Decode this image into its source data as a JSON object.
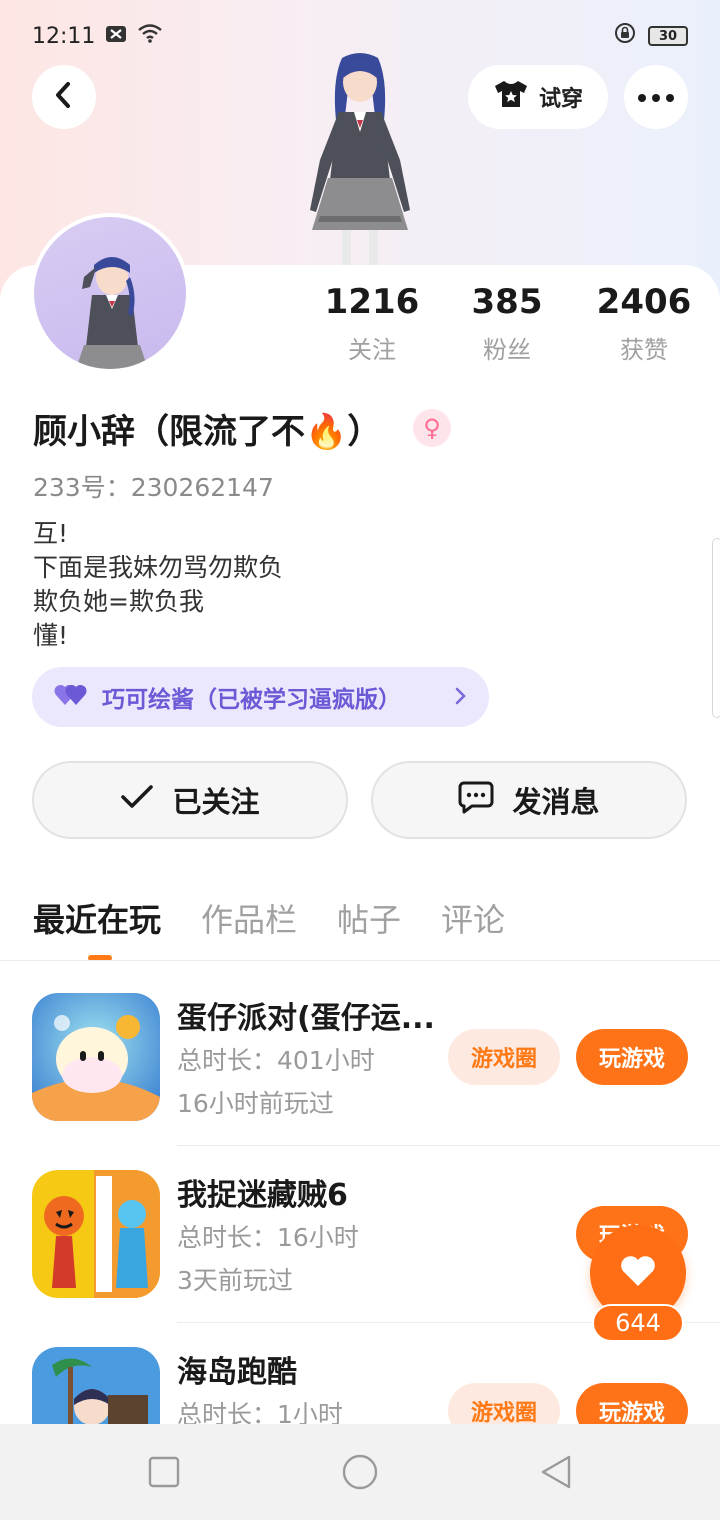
{
  "status_bar": {
    "time": "12:11",
    "battery": "30"
  },
  "header": {
    "tryon_label": "试穿"
  },
  "profile": {
    "name": "顾小辞（限流了不🔥）",
    "gender_symbol": "♀",
    "id_text": "233号：230262147",
    "bio": [
      "互!",
      "下面是我妹勿骂勿欺负",
      "欺负她=欺负我",
      "懂!"
    ],
    "cp_tag": "巧可绘酱（已被学习逼疯版）",
    "stats": [
      {
        "value": "1216",
        "label": "关注"
      },
      {
        "value": "385",
        "label": "粉丝"
      },
      {
        "value": "2406",
        "label": "获赞"
      }
    ]
  },
  "actions": {
    "follow_label": "已关注",
    "message_label": "发消息"
  },
  "tabs": [
    "最近在玩",
    "作品栏",
    "帖子",
    "评论"
  ],
  "games": [
    {
      "title": "蛋仔派对(蛋仔运...",
      "duration": "总时长：401小时",
      "last_played": "16小时前玩过",
      "circle_label": "游戏圈",
      "play_label": "玩游戏"
    },
    {
      "title": "我捉迷藏贼6",
      "duration": "总时长：16小时",
      "last_played": "3天前玩过",
      "circle_label": "",
      "play_label": "玩游戏"
    },
    {
      "title": "海岛跑酷",
      "duration": "总时长：1小时",
      "last_played": "",
      "circle_label": "游戏圈",
      "play_label": "玩游戏"
    }
  ],
  "like_fab": {
    "count": "644"
  },
  "colors": {
    "accent": "#ff7318",
    "tag_purple": "#6b59d6"
  }
}
